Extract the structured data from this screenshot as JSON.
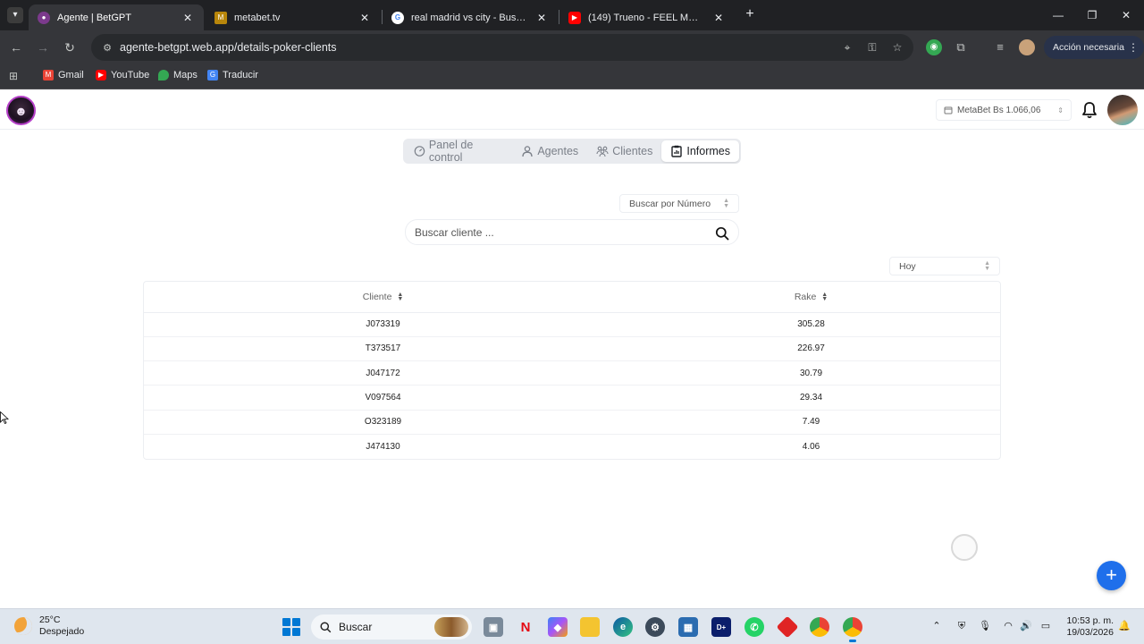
{
  "browser": {
    "tabs": [
      {
        "title": "Agente | BetGPT",
        "active": true,
        "icon": "betgpt-favicon"
      },
      {
        "title": "metabet.tv",
        "active": false,
        "icon": "metabet-favicon"
      },
      {
        "title": "real madrid vs city - Buscar con Google",
        "active": false,
        "icon": "google-favicon"
      },
      {
        "title": "(149) Trueno - FEEL ME?? (Video",
        "active": false,
        "icon": "youtube-favicon"
      }
    ],
    "url": "agente-betgpt.web.app/details-poker-clients",
    "action_button": "Acción necesaria",
    "bookmarks": [
      {
        "label": "Gmail",
        "icon": "gmail-icon"
      },
      {
        "label": "YouTube",
        "icon": "youtube-icon"
      },
      {
        "label": "Maps",
        "icon": "maps-icon"
      },
      {
        "label": "Traducir",
        "icon": "translate-icon"
      }
    ]
  },
  "header": {
    "balance": "MetaBet Bs 1.066,06"
  },
  "nav": {
    "items": [
      {
        "label": "Panel de control",
        "icon": "dashboard-icon",
        "active": false
      },
      {
        "label": "Agentes",
        "icon": "user-icon",
        "active": false
      },
      {
        "label": "Clientes",
        "icon": "users-icon",
        "active": false
      },
      {
        "label": "Informes",
        "icon": "report-icon",
        "active": true
      }
    ]
  },
  "filters": {
    "search_mode": "Buscar por Número",
    "search_placeholder": "Buscar cliente ...",
    "period": "Hoy"
  },
  "table": {
    "columns": [
      "Cliente",
      "Rake"
    ],
    "rows": [
      {
        "client": "J073319",
        "rake": "305.28"
      },
      {
        "client": "T373517",
        "rake": "226.97"
      },
      {
        "client": "J047172",
        "rake": "30.79"
      },
      {
        "client": "V097564",
        "rake": "29.34"
      },
      {
        "client": "O323189",
        "rake": "7.49"
      },
      {
        "client": "J474130",
        "rake": "4.06"
      }
    ]
  },
  "taskbar": {
    "weather_temp": "25°C",
    "weather_desc": "Despejado",
    "search_label": "Buscar",
    "time": "10:53 p. m.",
    "date": "19/03/2026"
  },
  "colors": {
    "accent": "#1f6feb",
    "chrome_dark": "#202124",
    "nav_bg": "#e9ebef"
  }
}
